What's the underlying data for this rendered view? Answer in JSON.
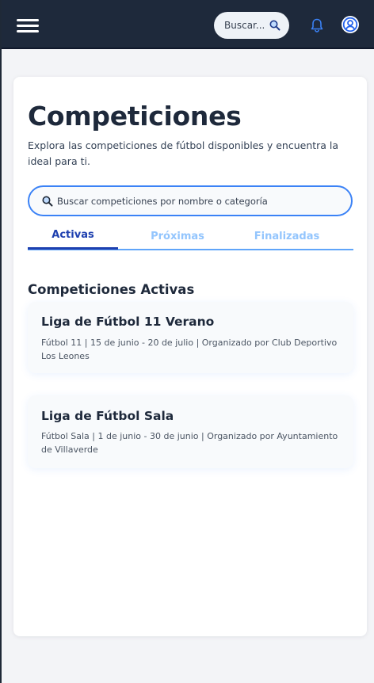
{
  "header": {
    "search_placeholder": "Buscar...",
    "icons": [
      "menu-icon",
      "search-icon",
      "bell-icon",
      "user-icon"
    ]
  },
  "page": {
    "title": "Competiciones",
    "subtitle": "Explora las competiciones de fútbol disponibles y encuentra la ideal para ti.",
    "search_placeholder": "Buscar competiciones por nombre o categoría"
  },
  "tabs": [
    {
      "label": "Activas",
      "active": true
    },
    {
      "label": "Próximas",
      "active": false
    },
    {
      "label": "Finalizadas",
      "active": false
    }
  ],
  "section": {
    "title": "Competiciones Activas"
  },
  "competitions": [
    {
      "name": "Liga de Fútbol 11 Verano",
      "meta": "Fútbol 11 | 15 de junio - 20 de julio | Organizado por Club Deportivo Los Leones"
    },
    {
      "name": "Liga de Fútbol Sala",
      "meta": "Fútbol Sala | 1 de junio - 30 de junio | Organizado por Ayuntamiento de Villaverde"
    }
  ],
  "colors": {
    "topbar": "#1e293b",
    "accent": "#1e40af",
    "tab_inactive": "#93c5fd",
    "search_border": "#3b82f6"
  }
}
